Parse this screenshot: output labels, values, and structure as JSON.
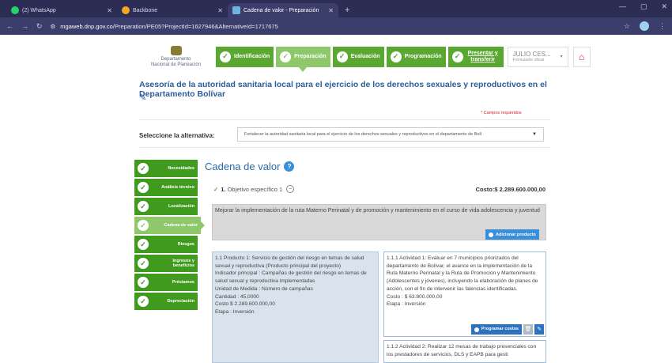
{
  "browser": {
    "tabs": [
      {
        "label": "(2) WhatsApp",
        "icon": "whatsapp-icon",
        "color": "#25d366"
      },
      {
        "label": "Backbone",
        "icon": "backbone-icon",
        "color": "#f5a623"
      },
      {
        "label": "Cadena de valor - Preparación",
        "icon": "site-icon",
        "color": "#6fb3e0"
      }
    ],
    "url_domain": "mgaweb.dnp.gov.co",
    "url_path": "/Preparation/PE05?ProjectId=1627946&AlternativeId=1717675"
  },
  "header": {
    "logo_line1": "Departamento",
    "logo_line2": "Nacional de Planeación",
    "steps": [
      {
        "label": "Identificación"
      },
      {
        "label": "Preparación"
      },
      {
        "label": "Evaluación"
      },
      {
        "label": "Programación"
      },
      {
        "label": "Presentar y transferir"
      }
    ],
    "user_name": "JULIO CES...",
    "user_role": "Formulador oficial"
  },
  "page": {
    "title": "Asesoría de la autoridad sanitaria local para el ejercicio de los derechos sexuales y reproductivos en el Departamento Bolívar",
    "required_note": "* Campos requeridos",
    "select_label": "Seleccione la alternativa:",
    "select_value": "Fortalecer la autoridad sanitaria local para el ejercicio de los derechos sexuales y reproductivos en el departamento de Bolí"
  },
  "sidebar": {
    "items": [
      {
        "label": "Necesidades"
      },
      {
        "label": "Análisis técnico"
      },
      {
        "label": "Localización"
      },
      {
        "label": "Cadena de valor"
      },
      {
        "label": "Riesgos"
      },
      {
        "label": "Ingresos y beneficios"
      },
      {
        "label": "Préstamos"
      },
      {
        "label": "Depreciación"
      }
    ]
  },
  "main": {
    "section_title": "Cadena de valor",
    "objective_num": "1.",
    "objective_label": "Objetivo específico 1",
    "objective_cost": "Costo:$ 2.289.600.000,00",
    "objective_text": "Mejorar la implementación de la ruta Materno Perinatal y de promoción y mantenimiento en el curso de vida adolescencia y juventud",
    "add_product_label": "Adicionar producto",
    "product_text": "1.1 Producto 1: Servicio de gestión del riesgo en temas de salud sexual y reproductiva (Producto principal del proyecto)",
    "product_indicator": "Indicador principal : Campañas de gestión del riesgo en temas de salud sexual y reproductiva implementadas",
    "product_unit": "Unidad de Medida : Número de campañas",
    "product_qty": "Cantidad : 45,0000",
    "product_cost": "Costo $ 2.289.600.000,00",
    "product_stage": "Etapa : Inversión",
    "activity1_text": "1.1.1 Actividad 1: Evaluar en 7 municipios priorizados del departamento de Bolívar, el avance en la implementación de la Ruta Materno Perinatal y la Ruta de Promoción y Mantenimiento (Adolescentes y jóvenes), incluyendo la elaboración de planes de acción, con el fin de intervenir las falencias identificadas.",
    "activity1_cost": "Costo : $ 63.800.000,00",
    "activity1_stage": "Etapa : Inversión",
    "program_costs_label": "Programar costos",
    "activity2_text": "1.1.2 Actividad 2: Realizar 12 mesas de trabajo presenciales con los prestadores de servicios, DLS y EAPB para gesti"
  }
}
